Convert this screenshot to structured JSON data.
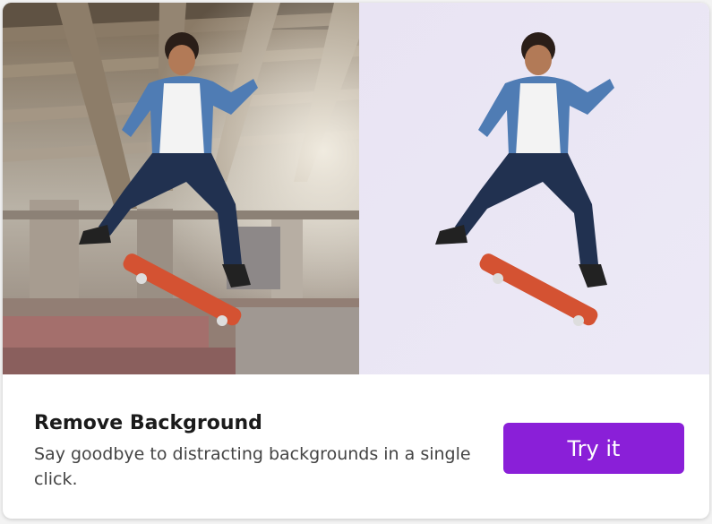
{
  "card": {
    "title": "Remove Background",
    "description": "Say goodbye to distracting backgrounds in a single click.",
    "button_label": "Try it"
  },
  "images": {
    "original": "skateboarder-with-background",
    "result": "skateboarder-background-removed"
  },
  "colors": {
    "accent": "#8a1fd8",
    "title_text": "#1b1b1b",
    "body_text": "#444444",
    "cutout_background": "#ece9f6"
  }
}
